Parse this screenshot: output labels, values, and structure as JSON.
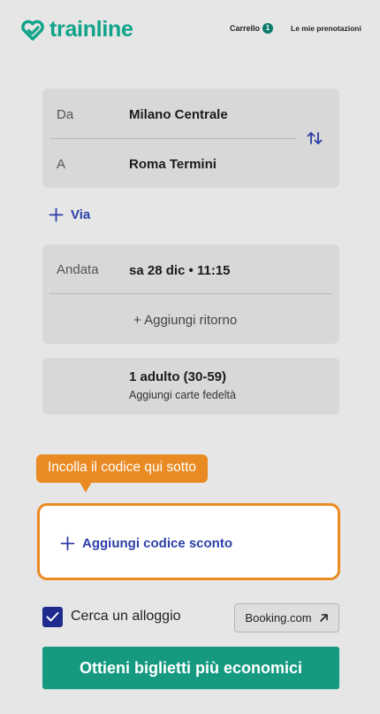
{
  "header": {
    "brand": "trainline",
    "cart_label": "Carrello",
    "cart_count": "1",
    "bookings_label": "Le mie prenotazioni"
  },
  "route": {
    "from_label": "Da",
    "from_value": "Milano Centrale",
    "to_label": "A",
    "to_value": "Roma Termini"
  },
  "via": {
    "label": "Via"
  },
  "dates": {
    "outbound_label": "Andata",
    "outbound_value": "sa 28 dic • 11:15",
    "add_return": "+ Aggiungi ritorno"
  },
  "passengers": {
    "summary": "1 adulto (30-59)",
    "add_cards": "Aggiungi carte fedeltà"
  },
  "tooltip": {
    "text": "Incolla il codice qui sotto"
  },
  "discount": {
    "label": "Aggiungi codice sconto"
  },
  "accommodation": {
    "checked": true,
    "label": "Cerca un alloggio",
    "partner": "Booking.com"
  },
  "cta": {
    "label": "Ottieni biglietti più economici"
  },
  "colors": {
    "brand": "#11a38a",
    "link": "#2c3ea6",
    "highlight": "#ea8a22",
    "cta": "#159a80"
  },
  "icons": [
    "trainline-logo-icon",
    "swap-icon",
    "plus-icon",
    "checkbox-check-icon",
    "external-arrow-icon"
  ]
}
